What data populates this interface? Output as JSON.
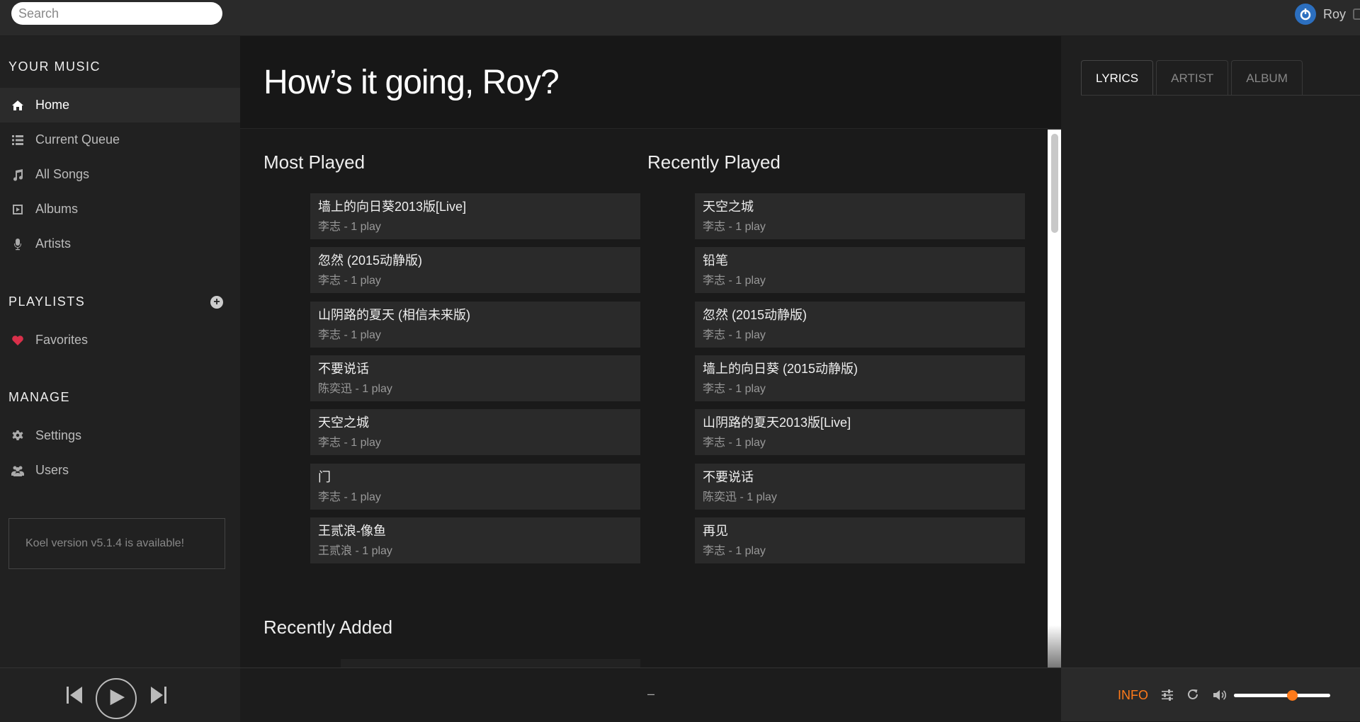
{
  "search": {
    "placeholder": "Search"
  },
  "user": {
    "name": "Roy"
  },
  "sidebar": {
    "your_music_title": "YOUR MUSIC",
    "items": [
      {
        "label": "Home",
        "icon": "home-icon"
      },
      {
        "label": "Current Queue",
        "icon": "list-icon"
      },
      {
        "label": "All Songs",
        "icon": "music-note-icon"
      },
      {
        "label": "Albums",
        "icon": "album-icon"
      },
      {
        "label": "Artists",
        "icon": "microphone-icon"
      }
    ],
    "playlists_title": "PLAYLISTS",
    "playlists": [
      {
        "label": "Favorites",
        "icon": "heart-icon"
      }
    ],
    "manage_title": "MANAGE",
    "manage_items": [
      {
        "label": "Settings",
        "icon": "gear-icon"
      },
      {
        "label": "Users",
        "icon": "users-icon"
      }
    ],
    "version_notice": "Koel version v5.1.4 is available!"
  },
  "main": {
    "greeting": "How’s it going, Roy?",
    "most_played_title": "Most Played",
    "recently_played_title": "Recently Played",
    "recently_added_title": "Recently Added",
    "most_played": [
      {
        "title": "墙上的向日葵2013版[Live]",
        "meta": "李志 - 1 play"
      },
      {
        "title": "忽然 (2015动静版)",
        "meta": "李志 - 1 play"
      },
      {
        "title": "山阴路的夏天 (相信未来版)",
        "meta": "李志 - 1 play"
      },
      {
        "title": "不要说话",
        "meta": "陈奕迅 - 1 play"
      },
      {
        "title": "天空之城",
        "meta": "李志 - 1 play"
      },
      {
        "title": "门",
        "meta": "李志 - 1 play"
      },
      {
        "title": "王贰浪-像鱼",
        "meta": "王贰浪 - 1 play"
      }
    ],
    "recently_played": [
      {
        "title": "天空之城",
        "meta": "李志 - 1 play"
      },
      {
        "title": "铅笔",
        "meta": "李志 - 1 play"
      },
      {
        "title": "忽然 (2015动静版)",
        "meta": "李志 - 1 play"
      },
      {
        "title": "墙上的向日葵 (2015动静版)",
        "meta": "李志 - 1 play"
      },
      {
        "title": "山阴路的夏天2013版[Live]",
        "meta": "李志 - 1 play"
      },
      {
        "title": "不要说话",
        "meta": "陈奕迅 - 1 play"
      },
      {
        "title": "再见",
        "meta": "李志 - 1 play"
      }
    ]
  },
  "extra": {
    "tabs": [
      "LYRICS",
      "ARTIST",
      "ALBUM"
    ]
  },
  "footer": {
    "now_playing": "–",
    "info_label": "INFO",
    "volume_fraction": 0.6,
    "accent_color": "#ff7a1a"
  }
}
